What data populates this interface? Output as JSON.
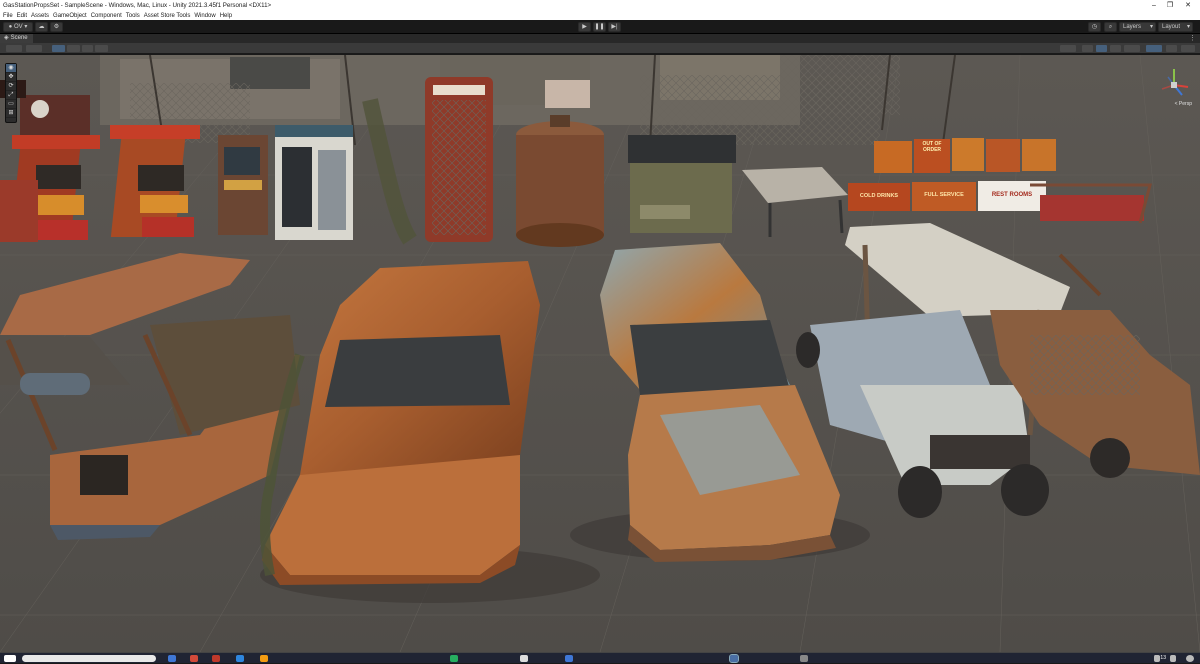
{
  "window": {
    "title": "GasStationPropsSet - SampleScene - Windows, Mac, Linux - Unity 2021.3.45f1 Personal <DX11>",
    "minimize": "–",
    "maximize": "❐",
    "close": "✕"
  },
  "menu": {
    "items": [
      "File",
      "Edit",
      "Assets",
      "GameObject",
      "Component",
      "Tools",
      "Asset Store Tools",
      "Window",
      "Help"
    ]
  },
  "toolbar": {
    "account": "OV",
    "layers": "Layers",
    "layout": "Layout"
  },
  "scene_tab": {
    "label": "Scene"
  },
  "gizmo": {
    "projection": "< Persp"
  },
  "signs": {
    "out_of_order": "OUT OF ORDER",
    "cold_drinks": "COLD DRINKS",
    "full_service": "FULL SERVICE",
    "rest_rooms": "REST ROOMS"
  },
  "taskbar": {
    "time": "11:13"
  },
  "colors": {
    "scene_bg": "#5a5651",
    "rust": "#b3683a",
    "rust_dark": "#7a3f1e",
    "sky_blue_paint": "#7e9aa6",
    "editor_dark": "#191919",
    "panel": "#3a3a3a",
    "accent": "#46607c"
  }
}
